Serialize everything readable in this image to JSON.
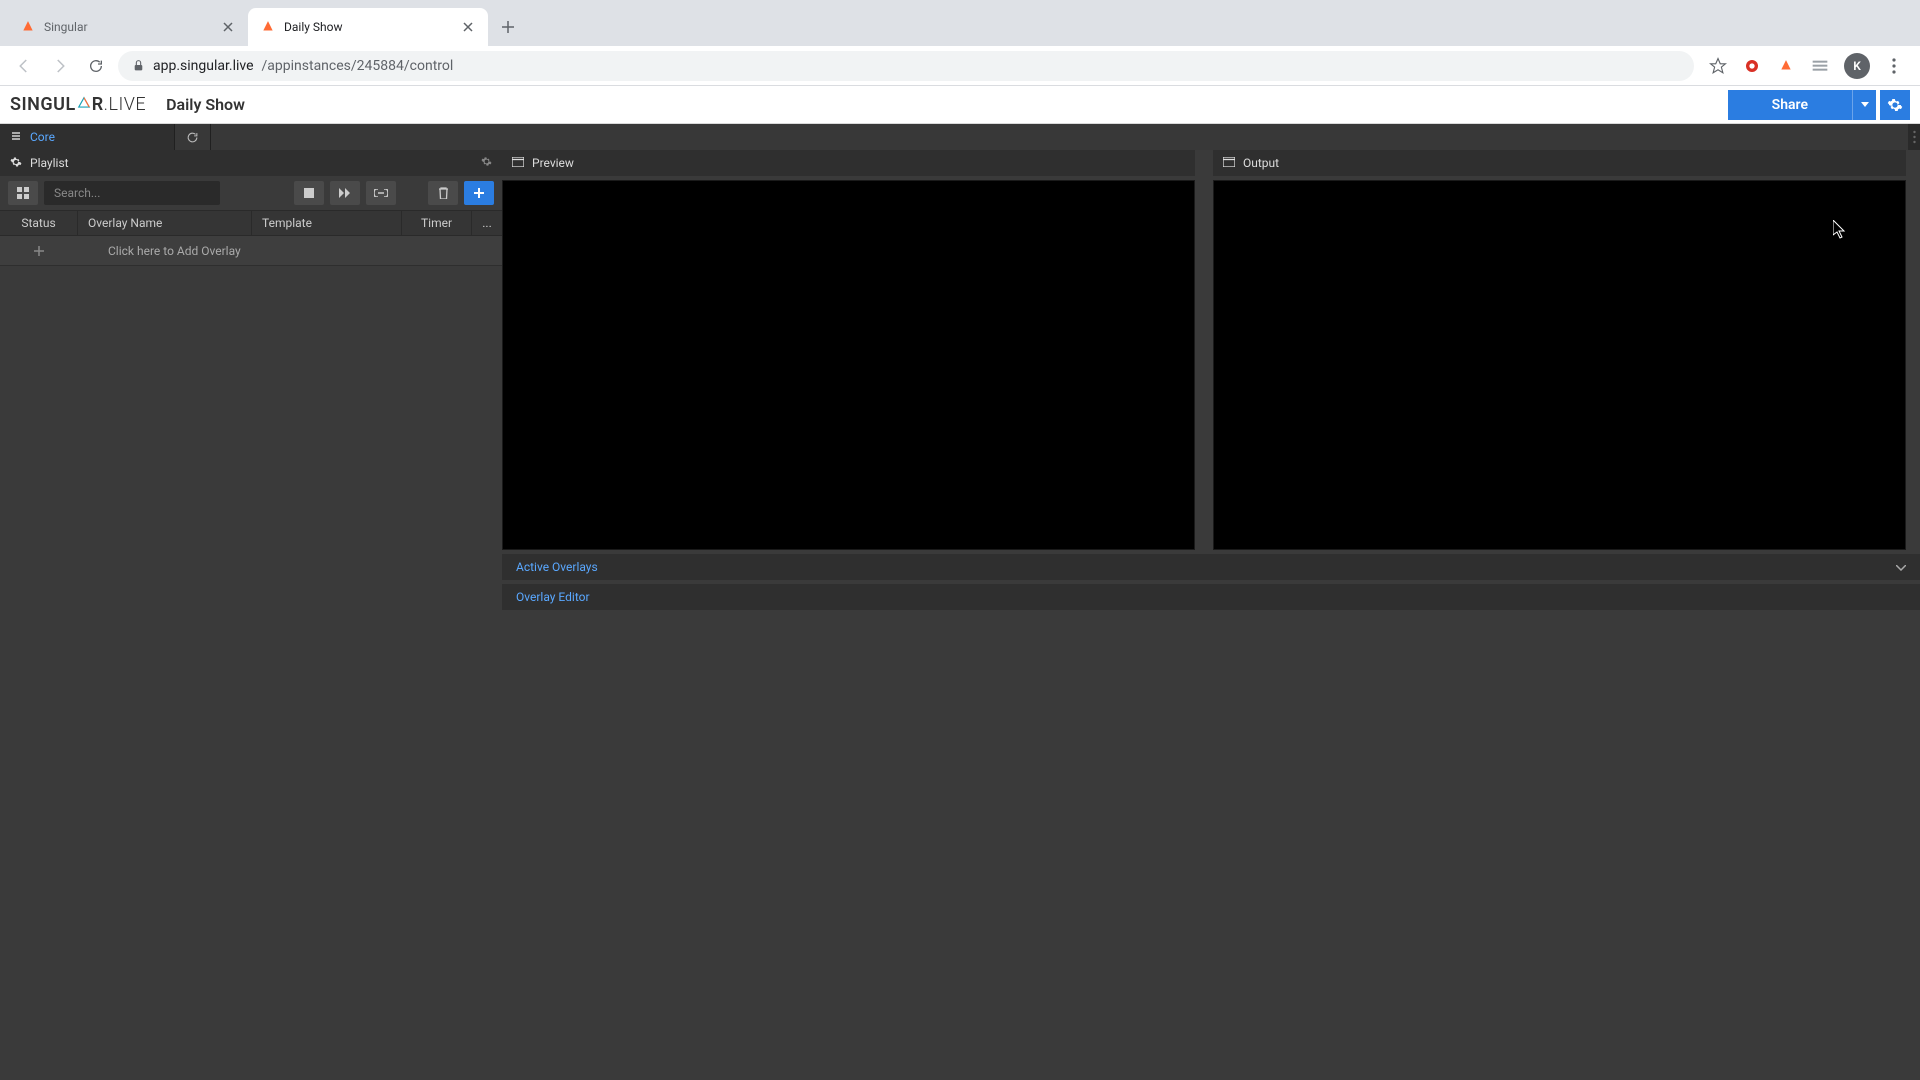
{
  "browser": {
    "tabs": [
      {
        "title": "Singular",
        "active": false
      },
      {
        "title": "Daily Show",
        "active": true
      }
    ],
    "url_host": "app.singular.live",
    "url_path": "/appinstances/245884/control",
    "avatar_initial": "K"
  },
  "header": {
    "brand_part1": "SINGUL",
    "brand_part2": "R",
    "brand_part3": ".LIVE",
    "show_name": "Daily Show",
    "share_label": "Share"
  },
  "subbar": {
    "core_label": "Core"
  },
  "playlist": {
    "title": "Playlist",
    "search_placeholder": "Search...",
    "columns": {
      "status": "Status",
      "name": "Overlay Name",
      "template": "Template",
      "timer": "Timer",
      "more": "..."
    },
    "add_overlay_text": "Click here to Add Overlay"
  },
  "panels": {
    "preview": "Preview",
    "output": "Output",
    "active_overlays": "Active Overlays",
    "overlay_editor": "Overlay Editor"
  }
}
